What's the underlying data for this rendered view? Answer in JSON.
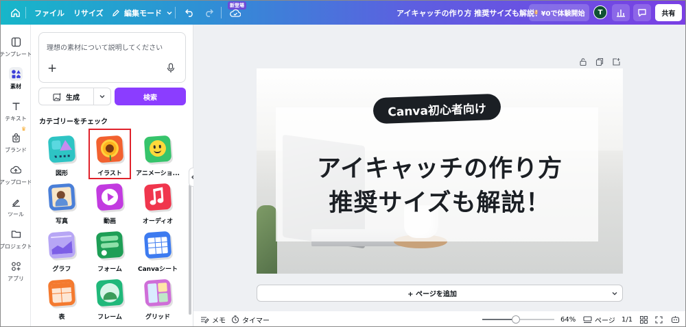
{
  "header": {
    "menu_file": "ファイル",
    "menu_resize": "リサイズ",
    "edit_mode": "編集モード",
    "new_badge": "新登場",
    "doc_title": "アイキャッチの作り方 推奨サイズも解説！",
    "trial_button": "¥0で体験開始",
    "avatar_initial": "T",
    "share_button": "共有"
  },
  "rail": {
    "items": [
      {
        "label": "テンプレート",
        "icon": "template-icon"
      },
      {
        "label": "素材",
        "icon": "elements-icon"
      },
      {
        "label": "テキスト",
        "icon": "text-icon"
      },
      {
        "label": "ブランド",
        "icon": "brand-icon"
      },
      {
        "label": "アップロード",
        "icon": "upload-icon"
      },
      {
        "label": "ツール",
        "icon": "tools-icon"
      },
      {
        "label": "プロジェクト",
        "icon": "folder-icon"
      },
      {
        "label": "アプリ",
        "icon": "apps-icon"
      }
    ]
  },
  "panel": {
    "search_placeholder": "理想の素材について説明してください",
    "generate_label": "生成",
    "search_button": "検索",
    "category_heading": "カテゴリーをチェック",
    "categories": [
      {
        "label": "図形"
      },
      {
        "label": "イラスト"
      },
      {
        "label": "アニメーショ..."
      },
      {
        "label": "写真"
      },
      {
        "label": "動画"
      },
      {
        "label": "オーディオ"
      },
      {
        "label": "グラフ"
      },
      {
        "label": "フォーム"
      },
      {
        "label": "Canvaシート"
      },
      {
        "label": "表"
      },
      {
        "label": "フレーム"
      },
      {
        "label": "グリッド"
      }
    ]
  },
  "design": {
    "pill_text": "Canva初心者向け",
    "title_line1": "アイキャッチの作り方",
    "title_line2": "推奨サイズも解説！"
  },
  "canvas": {
    "add_page": "+ ページを追加"
  },
  "bottombar": {
    "notes": "メモ",
    "timer": "タイマー",
    "zoom": "64%",
    "zoom_fraction": 0.47,
    "pages_label": "ページ",
    "page_count": "1/1"
  },
  "colors": {
    "accent": "#8b3dff",
    "highlight": "#e0202a"
  }
}
